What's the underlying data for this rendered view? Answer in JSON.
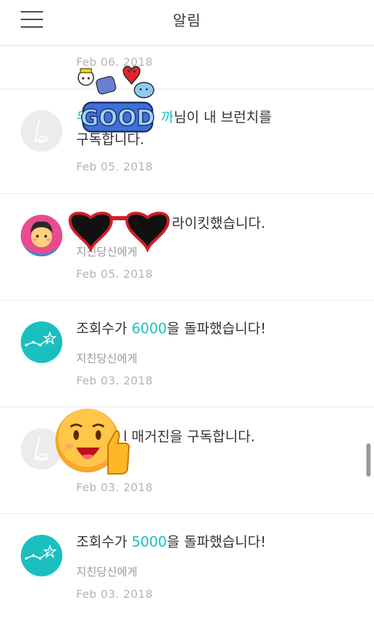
{
  "header": {
    "title": "알림",
    "menu_icon": "hamburger-menu-icon"
  },
  "notifications": [
    {
      "date": "Feb 06. 2018"
    },
    {
      "user_link": "우",
      "user_tail": "까",
      "message": "님이 내 브런치를",
      "message_line2": "구독합니다.",
      "date": "Feb 05. 2018",
      "avatar_icon": "brunch-b-logo-icon"
    },
    {
      "message_tail": "라이킷했습니다.",
      "sub": "지친당신에게",
      "date": "Feb 05. 2018",
      "avatar_icon": "cartoon-character-avatar"
    },
    {
      "message_prefix": "조회수가 ",
      "count": "6000",
      "message_suffix": "을 돌파했습니다!",
      "sub": "지친당신에게",
      "date": "Feb 03. 2018",
      "avatar_icon": "stats-graph-icon"
    },
    {
      "message_tail": "l 매거진을 구독합니다.",
      "date": "Feb 03. 2018",
      "avatar_icon": "brunch-b-logo-icon"
    },
    {
      "message_prefix": "조회수가 ",
      "count": "5000",
      "message_suffix": "을 돌파했습니다!",
      "sub": "지친당신에게",
      "date": "Feb 03. 2018",
      "avatar_icon": "stats-graph-icon"
    }
  ],
  "stickers": {
    "good_text": "GOOD",
    "good_sticker": "characters-good-sticker",
    "sunglasses": "heart-sunglasses-sticker",
    "thumbs": "thumbs-up-emoji-sticker"
  },
  "colors": {
    "accent": "#1bbfbf",
    "date": "#b3b3b3",
    "sub": "#9a9a9a"
  }
}
